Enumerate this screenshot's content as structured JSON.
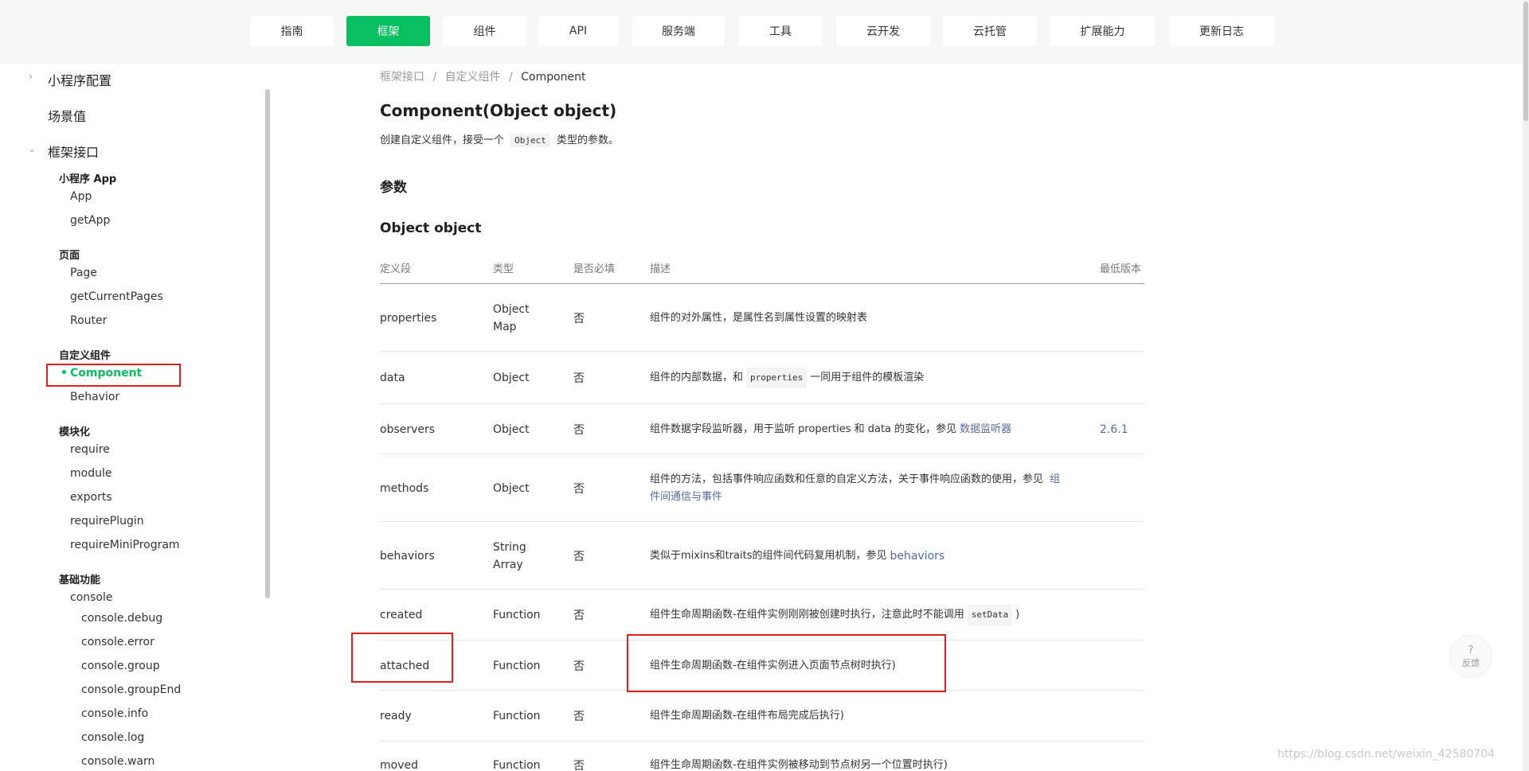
{
  "nav": {
    "items": [
      "指南",
      "框架",
      "组件",
      "API",
      "服务端",
      "工具",
      "云开发",
      "云托管",
      "扩展能力",
      "更新日志"
    ],
    "active": "框架"
  },
  "sidebar": {
    "top_items": [
      {
        "label": "小程序配置",
        "chevron": "›"
      },
      {
        "label": "场景值",
        "chevron": ""
      },
      {
        "label": "框架接口",
        "chevron": "⌄"
      }
    ],
    "groups": [
      {
        "heading": "小程序 App",
        "items": [
          "App",
          "getApp"
        ]
      },
      {
        "heading": "页面",
        "items": [
          "Page",
          "getCurrentPages",
          "Router"
        ]
      },
      {
        "heading": "自定义组件",
        "active": "Component",
        "items": [
          "Behavior"
        ]
      },
      {
        "heading": "模块化",
        "items": [
          "require",
          "module",
          "exports",
          "requirePlugin",
          "requireMiniProgram"
        ]
      },
      {
        "heading": "基础功能",
        "items": [
          "console"
        ],
        "subitems": [
          "console.debug",
          "console.error",
          "console.group",
          "console.groupEnd",
          "console.info",
          "console.log",
          "console.warn"
        ]
      }
    ],
    "active_bullet": "•"
  },
  "breadcrumb": {
    "items": [
      "框架接口",
      "自定义组件",
      "Component"
    ],
    "sep": "/"
  },
  "page": {
    "title": "Component(Object object)",
    "desc_before": "创建自定义组件，接受一个",
    "desc_code": "Object",
    "desc_after": "类型的参数。",
    "section_params": "参数",
    "section_object": "Object object"
  },
  "table": {
    "headers": [
      "定义段",
      "类型",
      "是否必填",
      "描述",
      "最低版本"
    ],
    "rows": [
      {
        "name": "properties",
        "type": "Object Map",
        "required": "否",
        "desc": "组件的对外属性，是属性名到属性设置的映射表",
        "version": ""
      },
      {
        "name": "data",
        "type": "Object",
        "required": "否",
        "desc_before": "组件的内部数据，和",
        "desc_code": "properties",
        "desc_after": "一同用于组件的模板渲染",
        "version": ""
      },
      {
        "name": "observers",
        "type": "Object",
        "required": "否",
        "desc": "组件数据字段监听器，用于监听 properties 和 data 的变化，参见",
        "desc_link": "数据监听器",
        "version": "2.6.1"
      },
      {
        "name": "methods",
        "type": "Object",
        "required": "否",
        "desc": "组件的方法，包括事件响应函数和任意的自定义方法，关于事件响应函数的使用，参见",
        "desc_link": "组件间通信与事件",
        "version": ""
      },
      {
        "name": "behaviors",
        "type": "String Array",
        "required": "否",
        "desc": "类似于mixins和traits的组件间代码复用机制，参见",
        "desc_link": "behaviors",
        "version": ""
      },
      {
        "name": "created",
        "type": "Function",
        "required": "否",
        "desc_before": "组件生命周期函数-在组件实例刚刚被创建时执行，注意此时不能调用",
        "desc_code": "setData",
        "desc_after": ")",
        "version": ""
      },
      {
        "name": "attached",
        "type": "Function",
        "required": "否",
        "desc": "组件生命周期函数-在组件实例进入页面节点树时执行)",
        "version": ""
      },
      {
        "name": "ready",
        "type": "Function",
        "required": "否",
        "desc": "组件生命周期函数-在组件布局完成后执行)",
        "version": ""
      },
      {
        "name": "moved",
        "type": "Function",
        "required": "否",
        "desc": "组件生命周期函数-在组件实例被移动到节点树另一个位置时执行)",
        "version": ""
      }
    ]
  },
  "feedback": {
    "icon": "?",
    "label": "反馈"
  },
  "watermark": "https://blog.csdn.net/weixin_42580704"
}
